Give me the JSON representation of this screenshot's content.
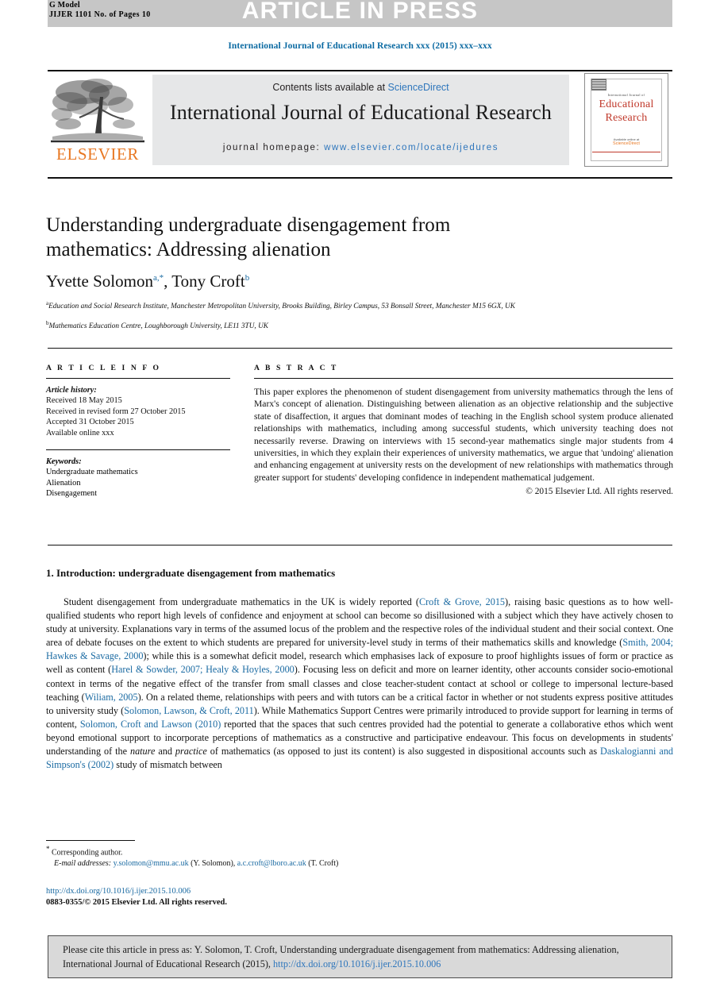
{
  "header": {
    "gmodel_line1": "G Model",
    "gmodel_line2": "JIJER 1101 No. of Pages 10",
    "banner": "ARTICLE IN PRESS",
    "banner_color": "#c6c6c6",
    "journal_running_head": "International Journal of Educational Research xxx (2015) xxx–xxx",
    "running_head_color": "#0b6aa2"
  },
  "masthead": {
    "contents_prefix": "Contents lists available at ",
    "contents_link": "ScienceDirect",
    "journal_title": "International Journal of Educational Research",
    "homepage_label": "journal homepage:",
    "homepage_url": "www.elsevier.com/locate/ijedures",
    "publisher_wordmark": "ELSEVIER",
    "publisher_color": "#e87722",
    "link_color": "#2e76bc",
    "box_background": "#e6e7e8",
    "cover": {
      "superline": "International Journal of",
      "line1": "Educational",
      "line2": "Research",
      "footer_small": "Available online at",
      "footer_brand": "ScienceDirect"
    }
  },
  "article": {
    "title": "Understanding undergraduate disengagement from mathematics: Addressing alienation",
    "authors_html": "Yvette Solomon<sup>a,*</sup>, Tony Croft<sup>b</sup>",
    "author_list": [
      {
        "name": "Yvette Solomon",
        "marks": "a,*"
      },
      {
        "name": "Tony Croft",
        "marks": "b"
      }
    ],
    "affiliations": [
      {
        "label": "a",
        "text": "Education and Social Research Institute, Manchester Metropolitan University, Brooks Building, Birley Campus, 53 Bonsall Street, Manchester M15 6GX, UK"
      },
      {
        "label": "b",
        "text": "Mathematics Education Centre, Loughborough University, LE11 3TU, UK"
      }
    ]
  },
  "article_info": {
    "section_label": "A R T I C L E   I N F O",
    "history_label": "Article history:",
    "history": [
      "Received 18 May 2015",
      "Received in revised form 27 October 2015",
      "Accepted 31 October 2015",
      "Available online xxx"
    ],
    "keywords_label": "Keywords:",
    "keywords": [
      "Undergraduate mathematics",
      "Alienation",
      "Disengagement"
    ]
  },
  "abstract": {
    "section_label": "A B S T R A C T",
    "text": "This paper explores the phenomenon of student disengagement from university mathematics through the lens of Marx's concept of alienation. Distinguishing between alienation as an objective relationship and the subjective state of disaffection, it argues that dominant modes of teaching in the English school system produce alienated relationships with mathematics, including among successful students, which university teaching does not necessarily reverse. Drawing on interviews with 15 second-year mathematics single major students from 4 universities, in which they explain their experiences of university mathematics, we argue that 'undoing' alienation and enhancing engagement at university rests on the development of new relationships with mathematics through greater support for students' developing confidence in independent mathematical judgement.",
    "copyright": "© 2015 Elsevier Ltd. All rights reserved."
  },
  "body": {
    "section_heading": "1. Introduction: undergraduate disengagement from mathematics",
    "paragraph_1_segments": [
      {
        "t": "Student disengagement from undergraduate mathematics in the UK is widely reported (",
        "k": "plain"
      },
      {
        "t": "Croft & Grove, 2015",
        "k": "ref"
      },
      {
        "t": "), raising basic questions as to how well- qualified students who report high levels of confidence and enjoyment at school can become so disillusioned with a subject which they have actively chosen to study at university. Explanations vary in terms of the assumed locus of the problem and the respective roles of the individual student and their social context. One area of debate focuses on the extent to which students are prepared for university-level study in terms of their mathematics skills and knowledge (",
        "k": "plain"
      },
      {
        "t": "Smith, 2004; Hawkes & Savage, 2000",
        "k": "ref"
      },
      {
        "t": "); while this is a somewhat deficit model, research which emphasises lack of exposure to proof highlights issues of form or practice as well as content (",
        "k": "plain"
      },
      {
        "t": "Harel & Sowder, 2007; Healy & Hoyles, 2000",
        "k": "ref"
      },
      {
        "t": "). Focusing less on deficit and more on learner identity, other accounts consider socio-emotional context in terms of the negative effect of the transfer from small classes and close teacher-student contact at school or college to impersonal lecture-based teaching (",
        "k": "plain"
      },
      {
        "t": "Wiliam, 2005",
        "k": "ref"
      },
      {
        "t": "). On a related theme, relationships with peers and with tutors can be a critical factor in whether or not students express positive attitudes to university study (",
        "k": "plain"
      },
      {
        "t": "Solomon, Lawson, & Croft, 2011",
        "k": "ref"
      },
      {
        "t": "). While Mathematics Support Centres were primarily introduced to provide support for learning in terms of content, ",
        "k": "plain"
      },
      {
        "t": "Solomon, Croft and Lawson (2010)",
        "k": "ref"
      },
      {
        "t": " reported that the spaces that such centres provided had the potential to generate a collaborative ethos which went beyond emotional support to incorporate perceptions of mathematics as a constructive and participative endeavour. This focus on developments in students' understanding of the ",
        "k": "plain"
      },
      {
        "t": "nature",
        "k": "italic"
      },
      {
        "t": " and ",
        "k": "plain"
      },
      {
        "t": "practice",
        "k": "italic"
      },
      {
        "t": " of mathematics (as opposed to just its content) is also suggested in dispositional accounts such as ",
        "k": "plain"
      },
      {
        "t": "Daskalogianni and Simpson's (2002)",
        "k": "ref"
      },
      {
        "t": " study of mismatch between",
        "k": "plain"
      }
    ]
  },
  "footer": {
    "corresponding_author": "Corresponding author.",
    "email_label": "E-mail addresses:",
    "emails": [
      {
        "address": "y.solomon@mmu.ac.uk",
        "person": "(Y. Solomon)"
      },
      {
        "address": "a.c.croft@lboro.ac.uk",
        "person": "(T. Croft)"
      }
    ],
    "doi": "http://dx.doi.org/10.1016/j.ijer.2015.10.006",
    "issn_line": "0883-0355/© 2015 Elsevier Ltd. All rights reserved."
  },
  "cite_box": {
    "prefix": "Please cite this article in press as: Y. Solomon, T. Croft, Understanding undergraduate disengagement from mathematics: Addressing alienation, International Journal of Educational Research (2015), ",
    "doi": "http://dx.doi.org/10.1016/j.ijer.2015.10.006",
    "background": "#d9d9d9"
  }
}
